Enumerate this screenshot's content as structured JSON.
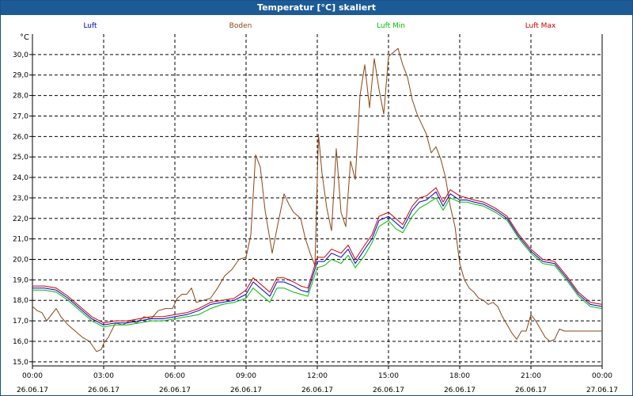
{
  "window": {
    "title": "Temperatur [°C] skaliert"
  },
  "chart_data": {
    "type": "line",
    "ylabel": "°C",
    "ylim": [
      14.8,
      31.0
    ],
    "xlim": [
      "00:00",
      "24:00"
    ],
    "grid": true,
    "legend_placement": "top",
    "y_ticks": [
      "15,0",
      "16,0",
      "17,0",
      "18,0",
      "19,0",
      "20,0",
      "21,0",
      "22,0",
      "23,0",
      "24,0",
      "25,0",
      "26,0",
      "27,0",
      "28,0",
      "29,0",
      "30,0"
    ],
    "x_ticks": [
      {
        "time": "00:00",
        "date": "26.06.17"
      },
      {
        "time": "03:00",
        "date": "26.06.17"
      },
      {
        "time": "06:00",
        "date": "26.06.17"
      },
      {
        "time": "09:00",
        "date": "26.06.17"
      },
      {
        "time": "12:00",
        "date": "26.06.17"
      },
      {
        "time": "15:00",
        "date": "26.06.17"
      },
      {
        "time": "18:00",
        "date": "26.06.17"
      },
      {
        "time": "21:00",
        "date": "26.06.17"
      },
      {
        "time": "00:00",
        "date": "27.06.17"
      }
    ],
    "series": [
      {
        "name": "Luft",
        "color": "#0000cc",
        "x": [
          0.0,
          0.5,
          1.0,
          1.5,
          2.0,
          2.5,
          3.0,
          3.5,
          4.0,
          4.5,
          5.0,
          5.5,
          6.0,
          6.5,
          7.0,
          7.5,
          8.0,
          8.5,
          9.0,
          9.3,
          9.6,
          10.0,
          10.3,
          10.6,
          11.0,
          11.3,
          11.6,
          12.0,
          12.3,
          12.6,
          13.0,
          13.3,
          13.6,
          14.0,
          14.3,
          14.6,
          15.0,
          15.3,
          15.6,
          16.0,
          16.3,
          16.6,
          17.0,
          17.3,
          17.6,
          18.0,
          18.3,
          18.6,
          19.0,
          19.5,
          20.0,
          20.5,
          21.0,
          21.5,
          22.0,
          22.5,
          23.0,
          23.5,
          24.0
        ],
        "y": [
          18.6,
          18.6,
          18.5,
          18.1,
          17.6,
          17.1,
          16.8,
          16.9,
          16.9,
          17.0,
          17.1,
          17.1,
          17.2,
          17.3,
          17.5,
          17.8,
          17.9,
          18.0,
          18.3,
          18.9,
          18.6,
          18.2,
          18.9,
          18.9,
          18.7,
          18.5,
          18.4,
          19.9,
          19.9,
          20.3,
          20.1,
          20.5,
          19.8,
          20.5,
          21.0,
          21.9,
          22.1,
          21.8,
          21.5,
          22.4,
          22.8,
          22.9,
          23.3,
          22.6,
          23.2,
          22.9,
          22.9,
          22.8,
          22.7,
          22.4,
          22.0,
          21.1,
          20.4,
          19.9,
          19.8,
          19.1,
          18.3,
          17.8,
          17.7
        ]
      },
      {
        "name": "Boden",
        "color": "#8b4513",
        "x": [
          0.0,
          0.2,
          0.4,
          0.6,
          0.8,
          1.0,
          1.2,
          1.5,
          1.8,
          2.1,
          2.4,
          2.7,
          2.9,
          3.0,
          3.2,
          3.5,
          3.8,
          4.1,
          4.4,
          4.7,
          5.0,
          5.3,
          5.6,
          5.9,
          6.1,
          6.3,
          6.5,
          6.7,
          6.9,
          7.2,
          7.5,
          7.8,
          8.1,
          8.4,
          8.7,
          9.0,
          9.2,
          9.4,
          9.6,
          9.8,
          10.1,
          10.3,
          10.6,
          10.8,
          11.0,
          11.3,
          11.5,
          11.7,
          11.9,
          12.05,
          12.2,
          12.4,
          12.6,
          12.8,
          13.0,
          13.2,
          13.4,
          13.6,
          13.8,
          14.0,
          14.2,
          14.4,
          14.6,
          14.8,
          15.0,
          15.2,
          15.4,
          15.6,
          15.8,
          16.0,
          16.2,
          16.4,
          16.6,
          16.8,
          17.0,
          17.2,
          17.4,
          17.6,
          17.8,
          18.0,
          18.2,
          18.4,
          18.6,
          18.8,
          19.0,
          19.2,
          19.4,
          19.6,
          19.8,
          20.0,
          20.2,
          20.4,
          20.6,
          20.8,
          21.0,
          21.2,
          21.4,
          21.6,
          21.8,
          22.0,
          22.2,
          22.4,
          22.6,
          22.8,
          23.0,
          23.2,
          23.4,
          23.6,
          23.8,
          24.0
        ],
        "y": [
          17.7,
          17.5,
          17.4,
          17.0,
          17.3,
          17.6,
          17.2,
          16.8,
          16.5,
          16.2,
          16.0,
          15.5,
          15.6,
          15.9,
          16.2,
          16.9,
          16.8,
          17.0,
          16.9,
          17.2,
          17.1,
          17.5,
          17.6,
          17.6,
          18.1,
          18.3,
          18.3,
          18.6,
          17.9,
          18.0,
          18.1,
          18.6,
          19.2,
          19.5,
          20.0,
          20.1,
          21.2,
          25.1,
          24.5,
          22.4,
          20.3,
          21.5,
          23.2,
          22.7,
          22.3,
          22.0,
          21.0,
          20.3,
          19.7,
          26.1,
          24.2,
          22.5,
          21.4,
          25.4,
          22.3,
          21.6,
          24.8,
          23.9,
          28.0,
          29.5,
          27.4,
          29.8,
          28.3,
          27.1,
          29.9,
          30.1,
          30.3,
          29.5,
          28.9,
          27.8,
          27.1,
          26.6,
          26.1,
          25.2,
          25.5,
          24.9,
          24.0,
          22.6,
          21.6,
          19.8,
          19.0,
          18.6,
          18.4,
          18.1,
          18.0,
          17.8,
          17.9,
          17.7,
          17.2,
          16.8,
          16.4,
          16.1,
          16.5,
          16.5,
          17.3,
          17.0,
          16.6,
          16.2,
          16.0,
          16.1,
          16.6,
          16.5,
          16.5,
          16.5,
          16.5,
          16.5,
          16.5,
          16.5,
          16.5,
          16.5
        ]
      },
      {
        "name": "Luft Min",
        "color": "#00bb00",
        "x": [
          0.0,
          0.5,
          1.0,
          1.5,
          2.0,
          2.5,
          3.0,
          3.5,
          4.0,
          4.5,
          5.0,
          5.5,
          6.0,
          6.5,
          7.0,
          7.5,
          8.0,
          8.5,
          9.0,
          9.3,
          9.6,
          10.0,
          10.3,
          10.6,
          11.0,
          11.3,
          11.6,
          12.0,
          12.3,
          12.6,
          13.0,
          13.3,
          13.6,
          14.0,
          14.3,
          14.6,
          15.0,
          15.3,
          15.6,
          16.0,
          16.3,
          16.6,
          17.0,
          17.3,
          17.6,
          18.0,
          18.3,
          18.6,
          19.0,
          19.5,
          20.0,
          20.5,
          21.0,
          21.5,
          22.0,
          22.5,
          23.0,
          23.5,
          24.0
        ],
        "y": [
          18.5,
          18.5,
          18.4,
          18.0,
          17.5,
          17.0,
          16.7,
          16.8,
          16.8,
          16.9,
          17.0,
          17.0,
          17.1,
          17.2,
          17.3,
          17.6,
          17.8,
          17.9,
          18.1,
          18.6,
          18.3,
          17.9,
          18.6,
          18.6,
          18.4,
          18.3,
          18.2,
          19.6,
          19.7,
          20.0,
          19.8,
          20.2,
          19.6,
          20.2,
          20.8,
          21.6,
          21.9,
          21.5,
          21.3,
          22.1,
          22.5,
          22.7,
          23.0,
          22.4,
          23.0,
          22.8,
          22.8,
          22.7,
          22.6,
          22.3,
          21.9,
          21.0,
          20.3,
          19.8,
          19.7,
          19.0,
          18.2,
          17.7,
          17.6
        ]
      },
      {
        "name": "Luft Max",
        "color": "#cc0000",
        "x": [
          0.0,
          0.5,
          1.0,
          1.5,
          2.0,
          2.5,
          3.0,
          3.5,
          4.0,
          4.5,
          5.0,
          5.5,
          6.0,
          6.5,
          7.0,
          7.5,
          8.0,
          8.5,
          9.0,
          9.3,
          9.6,
          10.0,
          10.3,
          10.6,
          11.0,
          11.3,
          11.6,
          12.0,
          12.3,
          12.6,
          13.0,
          13.3,
          13.6,
          14.0,
          14.3,
          14.6,
          15.0,
          15.3,
          15.6,
          16.0,
          16.3,
          16.6,
          17.0,
          17.3,
          17.6,
          18.0,
          18.3,
          18.6,
          19.0,
          19.5,
          20.0,
          20.5,
          21.0,
          21.5,
          22.0,
          22.5,
          23.0,
          23.5,
          24.0
        ],
        "y": [
          18.7,
          18.7,
          18.6,
          18.2,
          17.7,
          17.2,
          16.9,
          17.0,
          17.0,
          17.1,
          17.2,
          17.2,
          17.3,
          17.4,
          17.6,
          17.9,
          18.0,
          18.1,
          18.5,
          19.1,
          18.8,
          18.4,
          19.1,
          19.1,
          18.9,
          18.7,
          18.6,
          20.1,
          20.1,
          20.5,
          20.3,
          20.7,
          20.0,
          20.7,
          21.2,
          22.1,
          22.3,
          22.0,
          21.7,
          22.6,
          23.0,
          23.1,
          23.5,
          22.8,
          23.4,
          23.1,
          23.0,
          22.9,
          22.8,
          22.5,
          22.1,
          21.2,
          20.5,
          20.0,
          19.9,
          19.2,
          18.4,
          17.9,
          17.8
        ]
      }
    ]
  }
}
